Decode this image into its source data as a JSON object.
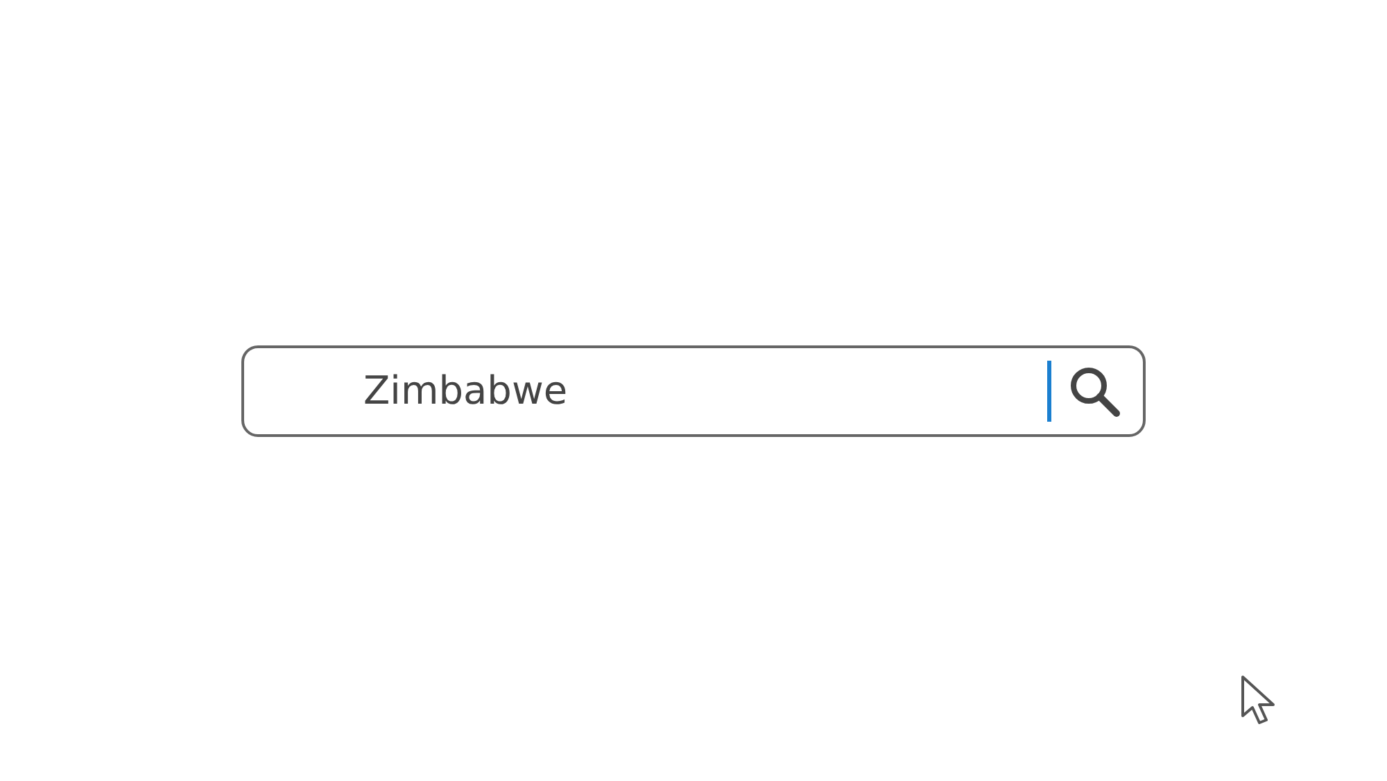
{
  "search": {
    "value": "Zimbabwe",
    "focused": true
  }
}
